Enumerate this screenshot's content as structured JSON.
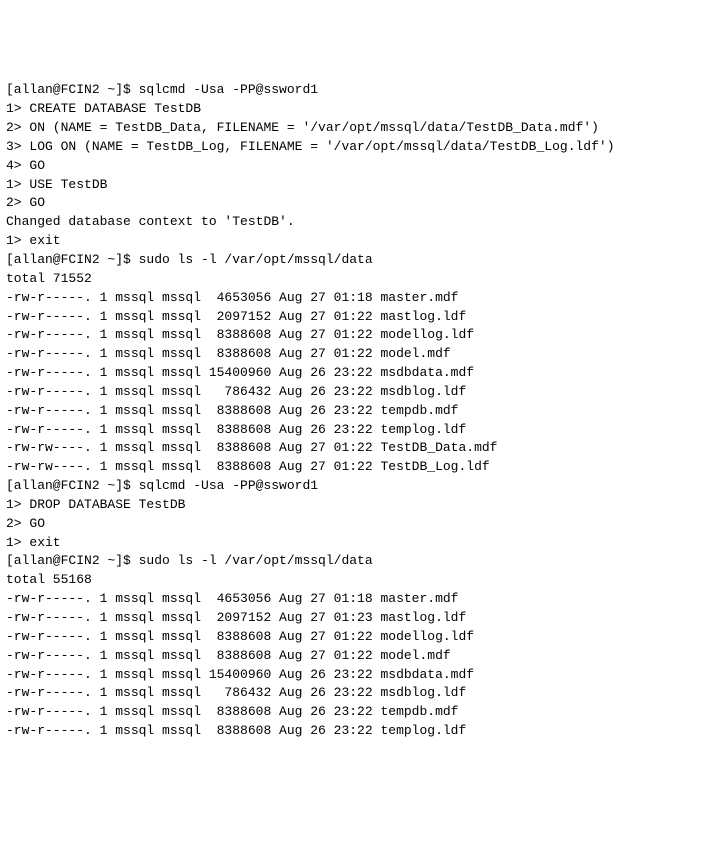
{
  "lines": [
    "[allan@FCIN2 ~]$ sqlcmd -Usa -PP@ssword1",
    "1> CREATE DATABASE TestDB",
    "2> ON (NAME = TestDB_Data, FILENAME = '/var/opt/mssql/data/TestDB_Data.mdf')",
    "3> LOG ON (NAME = TestDB_Log, FILENAME = '/var/opt/mssql/data/TestDB_Log.ldf')",
    "4> GO",
    "1> USE TestDB",
    "2> GO",
    "Changed database context to 'TestDB'.",
    "1> exit",
    "[allan@FCIN2 ~]$ sudo ls -l /var/opt/mssql/data",
    "total 71552",
    "-rw-r-----. 1 mssql mssql  4653056 Aug 27 01:18 master.mdf",
    "-rw-r-----. 1 mssql mssql  2097152 Aug 27 01:22 mastlog.ldf",
    "-rw-r-----. 1 mssql mssql  8388608 Aug 27 01:22 modellog.ldf",
    "-rw-r-----. 1 mssql mssql  8388608 Aug 27 01:22 model.mdf",
    "-rw-r-----. 1 mssql mssql 15400960 Aug 26 23:22 msdbdata.mdf",
    "-rw-r-----. 1 mssql mssql   786432 Aug 26 23:22 msdblog.ldf",
    "-rw-r-----. 1 mssql mssql  8388608 Aug 26 23:22 tempdb.mdf",
    "-rw-r-----. 1 mssql mssql  8388608 Aug 26 23:22 templog.ldf",
    "-rw-rw----. 1 mssql mssql  8388608 Aug 27 01:22 TestDB_Data.mdf",
    "-rw-rw----. 1 mssql mssql  8388608 Aug 27 01:22 TestDB_Log.ldf",
    "[allan@FCIN2 ~]$ sqlcmd -Usa -PP@ssword1",
    "1> DROP DATABASE TestDB",
    "2> GO",
    "1> exit",
    "[allan@FCIN2 ~]$ sudo ls -l /var/opt/mssql/data",
    "total 55168",
    "-rw-r-----. 1 mssql mssql  4653056 Aug 27 01:18 master.mdf",
    "-rw-r-----. 1 mssql mssql  2097152 Aug 27 01:23 mastlog.ldf",
    "-rw-r-----. 1 mssql mssql  8388608 Aug 27 01:22 modellog.ldf",
    "-rw-r-----. 1 mssql mssql  8388608 Aug 27 01:22 model.mdf",
    "-rw-r-----. 1 mssql mssql 15400960 Aug 26 23:22 msdbdata.mdf",
    "-rw-r-----. 1 mssql mssql   786432 Aug 26 23:22 msdblog.ldf",
    "-rw-r-----. 1 mssql mssql  8388608 Aug 26 23:22 tempdb.mdf",
    "-rw-r-----. 1 mssql mssql  8388608 Aug 26 23:22 templog.ldf"
  ]
}
